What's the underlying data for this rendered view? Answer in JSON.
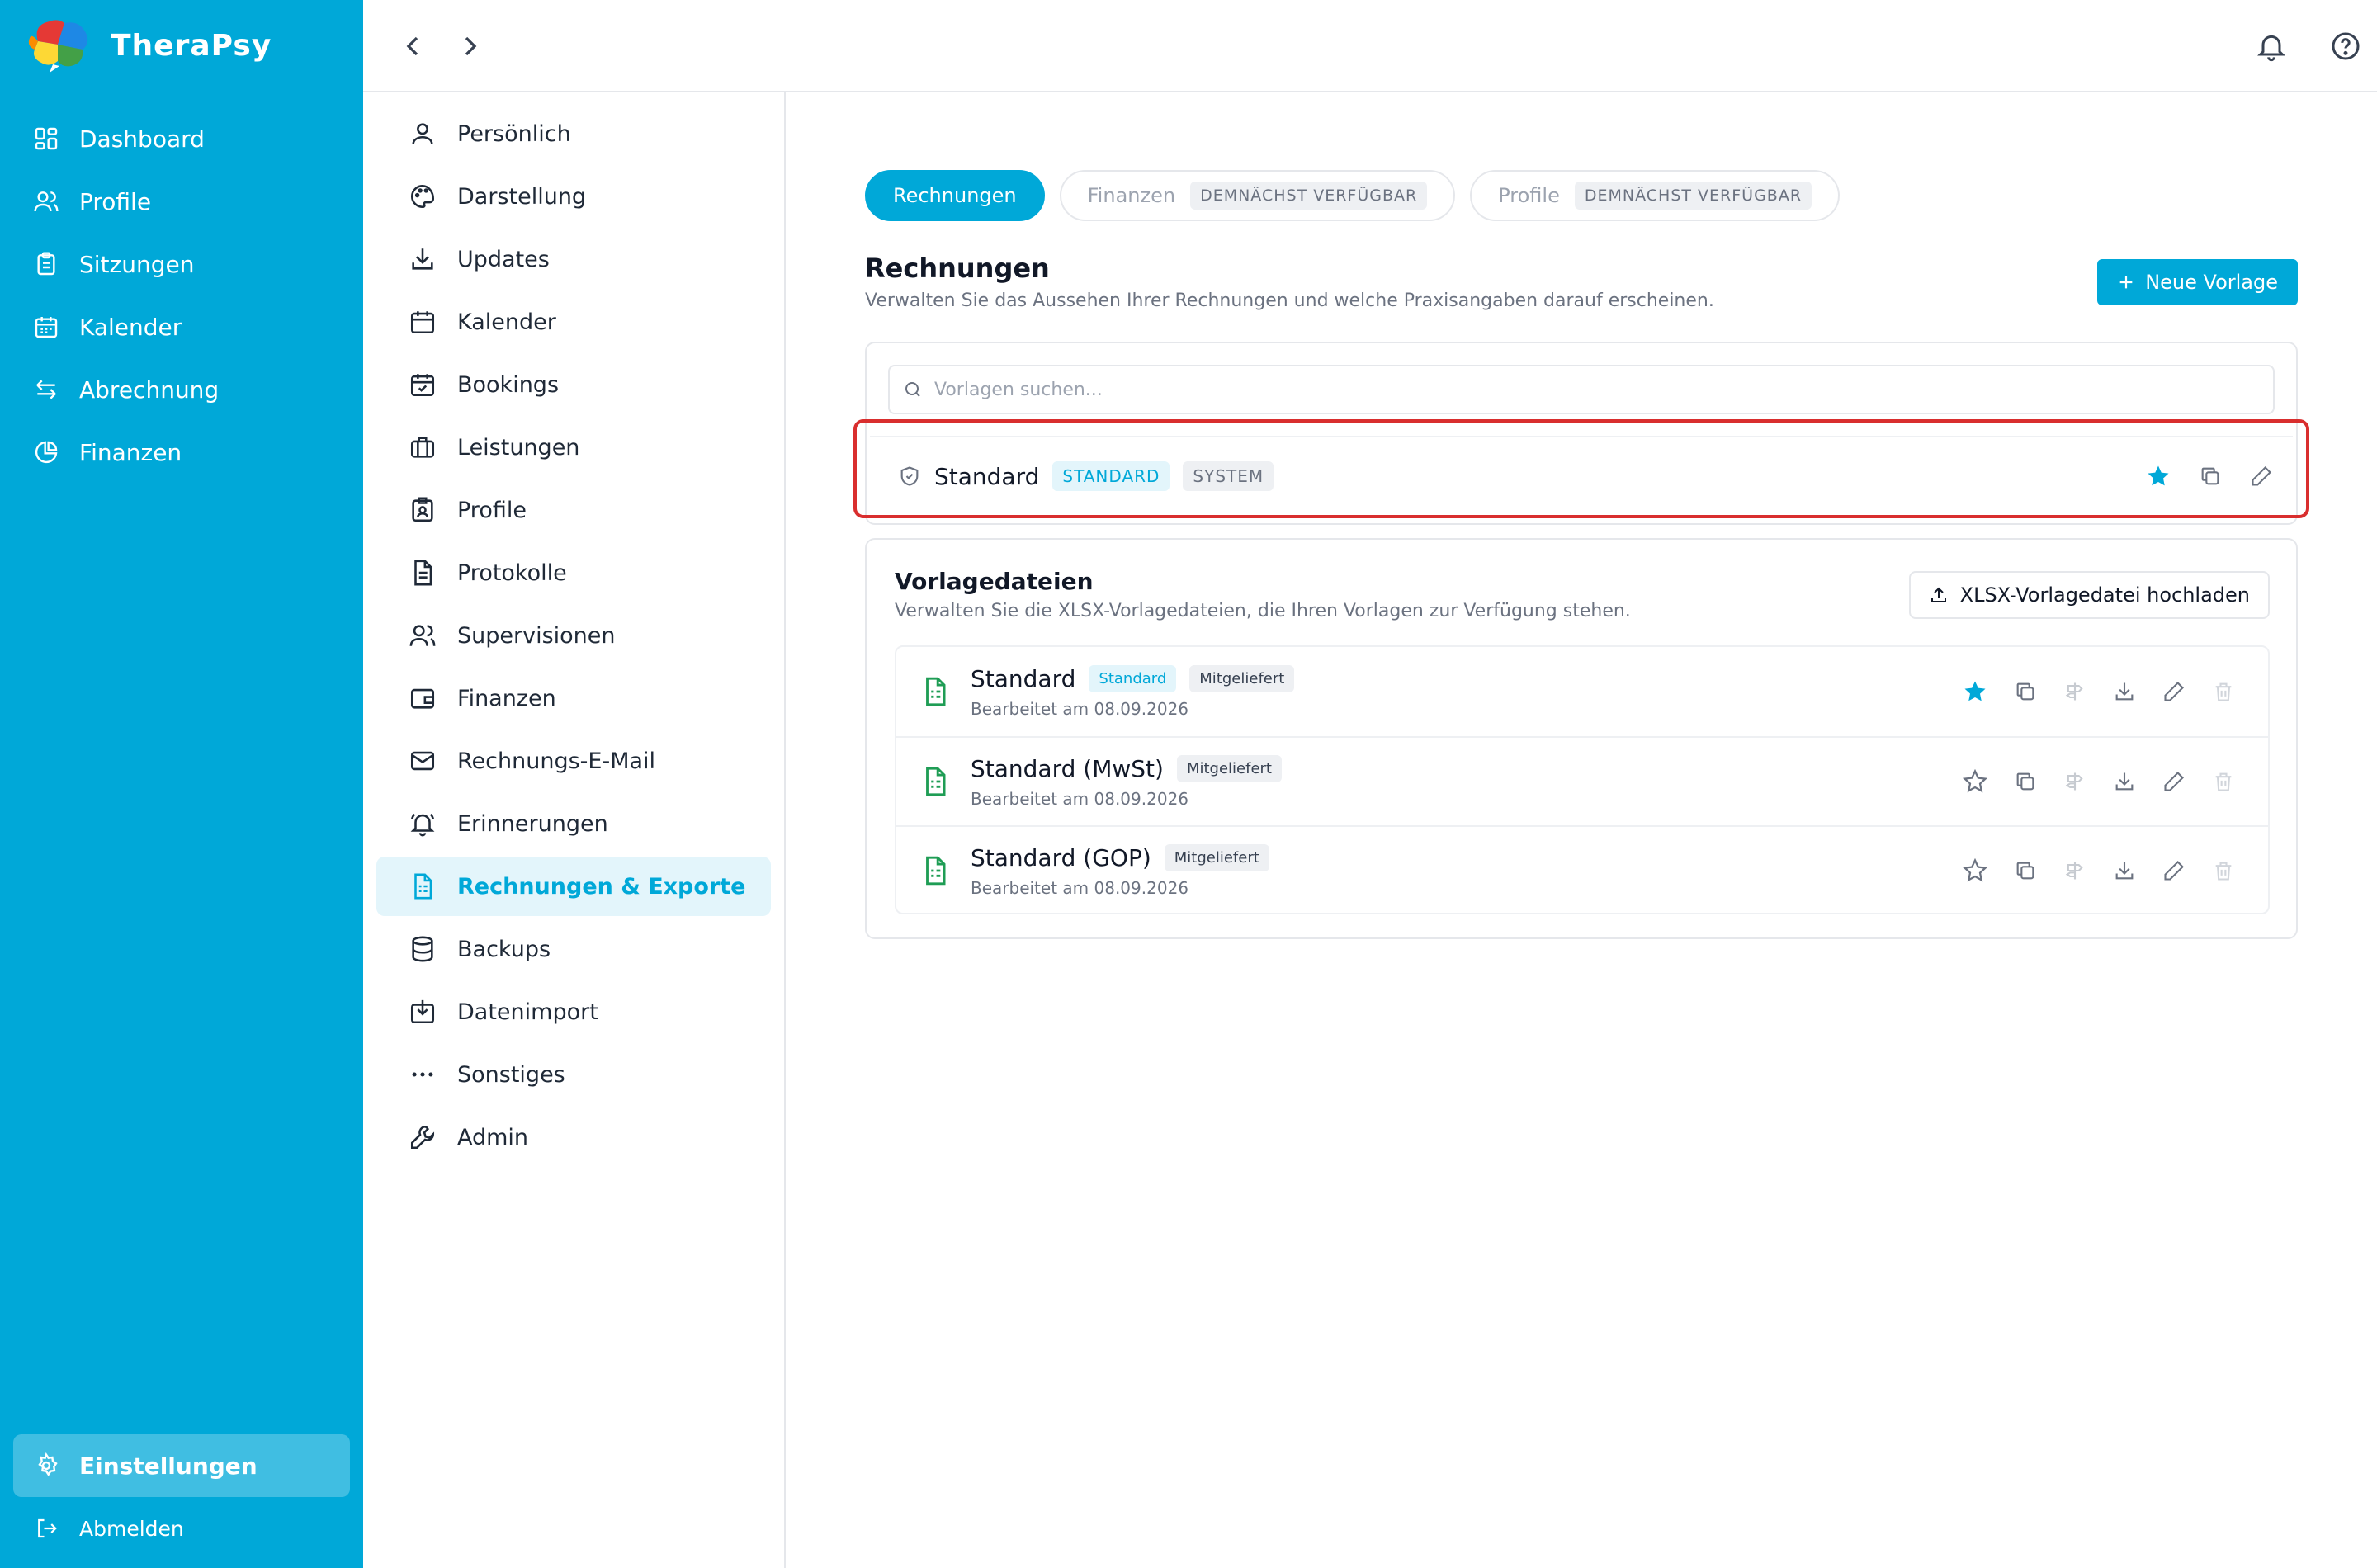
{
  "app": {
    "name": "TheraPsy"
  },
  "sidebar": {
    "items": [
      {
        "label": "Dashboard",
        "icon": "dashboard-icon"
      },
      {
        "label": "Profile",
        "icon": "users-icon"
      },
      {
        "label": "Sitzungen",
        "icon": "clipboard-icon"
      },
      {
        "label": "Kalender",
        "icon": "calendar-icon"
      },
      {
        "label": "Abrechnung",
        "icon": "transfer-icon"
      },
      {
        "label": "Finanzen",
        "icon": "pie-chart-icon"
      }
    ],
    "settings_label": "Einstellungen",
    "logout_label": "Abmelden"
  },
  "settings_nav": {
    "items": [
      {
        "label": "Persönlich",
        "icon": "user-icon"
      },
      {
        "label": "Darstellung",
        "icon": "palette-icon"
      },
      {
        "label": "Updates",
        "icon": "download-icon"
      },
      {
        "label": "Kalender",
        "icon": "calendar-icon"
      },
      {
        "label": "Bookings",
        "icon": "calendar-check-icon"
      },
      {
        "label": "Leistungen",
        "icon": "briefcase-icon"
      },
      {
        "label": "Profile",
        "icon": "badge-icon"
      },
      {
        "label": "Protokolle",
        "icon": "document-icon"
      },
      {
        "label": "Supervisionen",
        "icon": "users-icon"
      },
      {
        "label": "Finanzen",
        "icon": "wallet-icon"
      },
      {
        "label": "Rechnungs-E-Mail",
        "icon": "mail-icon"
      },
      {
        "label": "Erinnerungen",
        "icon": "bell-ring-icon"
      },
      {
        "label": "Rechnungen & Exporte",
        "icon": "spreadsheet-icon"
      },
      {
        "label": "Backups",
        "icon": "database-icon"
      },
      {
        "label": "Datenimport",
        "icon": "import-icon"
      },
      {
        "label": "Sonstiges",
        "icon": "more-icon"
      },
      {
        "label": "Admin",
        "icon": "wrench-icon"
      }
    ],
    "active_index": 12
  },
  "tabs": [
    {
      "label": "Rechnungen",
      "badge": ""
    },
    {
      "label": "Finanzen",
      "badge": "DEMNÄCHST VERFÜGBAR"
    },
    {
      "label": "Profile",
      "badge": "DEMNÄCHST VERFÜGBAR"
    }
  ],
  "rechnungen": {
    "title": "Rechnungen",
    "subtitle": "Verwalten Sie das Aussehen Ihrer Rechnungen und welche Praxisangaben darauf erscheinen.",
    "new_button": "Neue Vorlage",
    "search_placeholder": "Vorlagen suchen...",
    "template": {
      "name": "Standard",
      "tag1": "STANDARD",
      "tag2": "SYSTEM"
    }
  },
  "vorlagedateien": {
    "title": "Vorlagedateien",
    "subtitle": "Verwalten Sie die XLSX-Vorlagedateien, die Ihren Vorlagen zur Verfügung stehen.",
    "upload_button": "XLSX-Vorlagedatei hochladen",
    "files": [
      {
        "name": "Standard",
        "badge_default": "Standard",
        "badge": "Mitgeliefert",
        "edited": "Bearbeitet am 08.09.2026",
        "starred": true
      },
      {
        "name": "Standard (MwSt)",
        "badge": "Mitgeliefert",
        "edited": "Bearbeitet am 08.09.2026",
        "starred": false
      },
      {
        "name": "Standard (GOP)",
        "badge": "Mitgeliefert",
        "edited": "Bearbeitet am 08.09.2026",
        "starred": false
      }
    ]
  },
  "colors": {
    "accent": "#00a8d8",
    "highlight": "#d92e2e",
    "file_icon": "#1f9d55"
  }
}
